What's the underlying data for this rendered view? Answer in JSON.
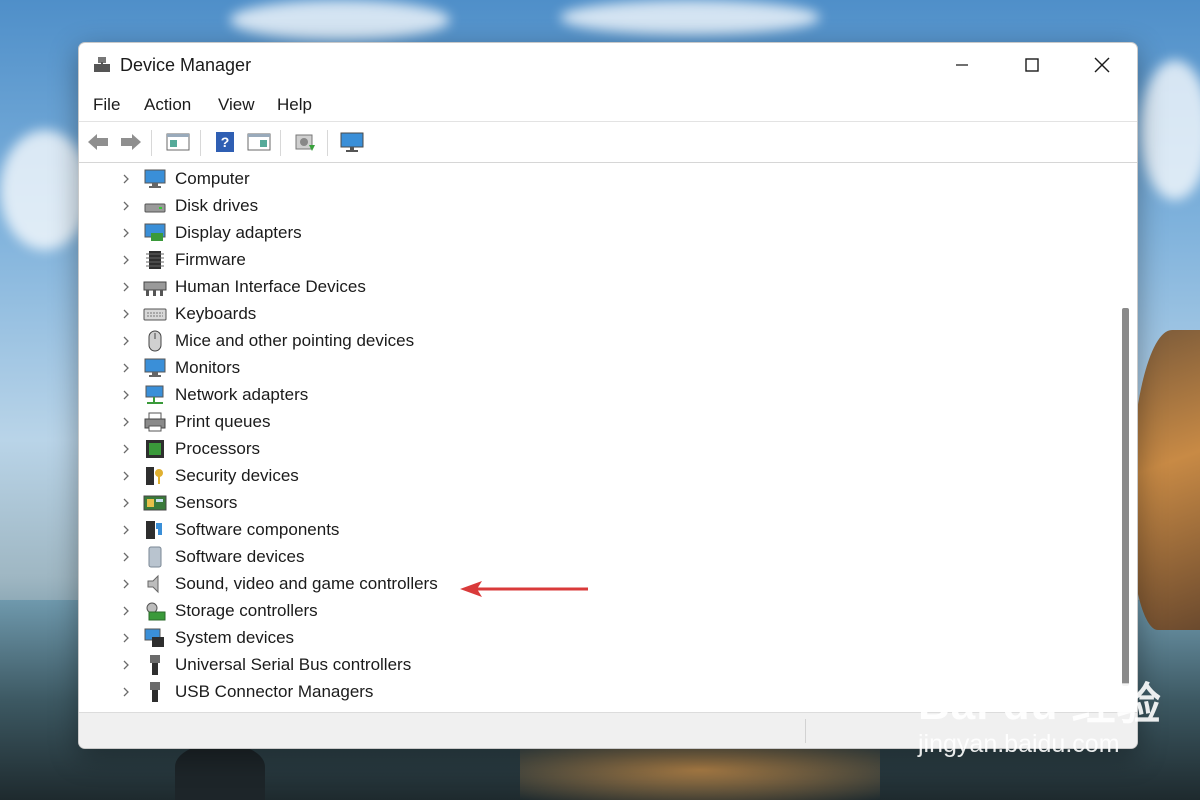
{
  "window": {
    "title": "Device Manager",
    "controls": [
      "minimize",
      "maximize",
      "close"
    ]
  },
  "menu": [
    "File",
    "Action",
    "View",
    "Help"
  ],
  "toolbar": {
    "buttons": [
      "back-icon",
      "forward-icon",
      "show-hide-console-tree-icon",
      "help-icon",
      "properties-icon",
      "scan-hardware-icon",
      "monitor-icon"
    ]
  },
  "devices": [
    {
      "label": "Computer",
      "icon": "computer-icon"
    },
    {
      "label": "Disk drives",
      "icon": "disk-drive-icon"
    },
    {
      "label": "Display adapters",
      "icon": "display-adapter-icon"
    },
    {
      "label": "Firmware",
      "icon": "firmware-icon"
    },
    {
      "label": "Human Interface Devices",
      "icon": "hid-icon"
    },
    {
      "label": "Keyboards",
      "icon": "keyboard-icon"
    },
    {
      "label": "Mice and other pointing devices",
      "icon": "mouse-icon"
    },
    {
      "label": "Monitors",
      "icon": "monitor-icon"
    },
    {
      "label": "Network adapters",
      "icon": "network-adapter-icon"
    },
    {
      "label": "Print queues",
      "icon": "printer-icon"
    },
    {
      "label": "Processors",
      "icon": "processor-icon"
    },
    {
      "label": "Security devices",
      "icon": "security-device-icon"
    },
    {
      "label": "Sensors",
      "icon": "sensor-icon"
    },
    {
      "label": "Software components",
      "icon": "software-component-icon"
    },
    {
      "label": "Software devices",
      "icon": "software-device-icon"
    },
    {
      "label": "Sound, video and game controllers",
      "icon": "speaker-icon"
    },
    {
      "label": "Storage controllers",
      "icon": "storage-controller-icon"
    },
    {
      "label": "System devices",
      "icon": "system-device-icon"
    },
    {
      "label": "Universal Serial Bus controllers",
      "icon": "usb-icon"
    },
    {
      "label": "USB Connector Managers",
      "icon": "usb-connector-icon"
    }
  ],
  "annotation": {
    "arrow_color": "#d93a3a"
  },
  "watermark": {
    "logo": "Bai du 经验",
    "url": "jingyan.baidu.com"
  },
  "colors": {
    "accent": "#1e78d7",
    "chevron": "#6b6b6b"
  }
}
